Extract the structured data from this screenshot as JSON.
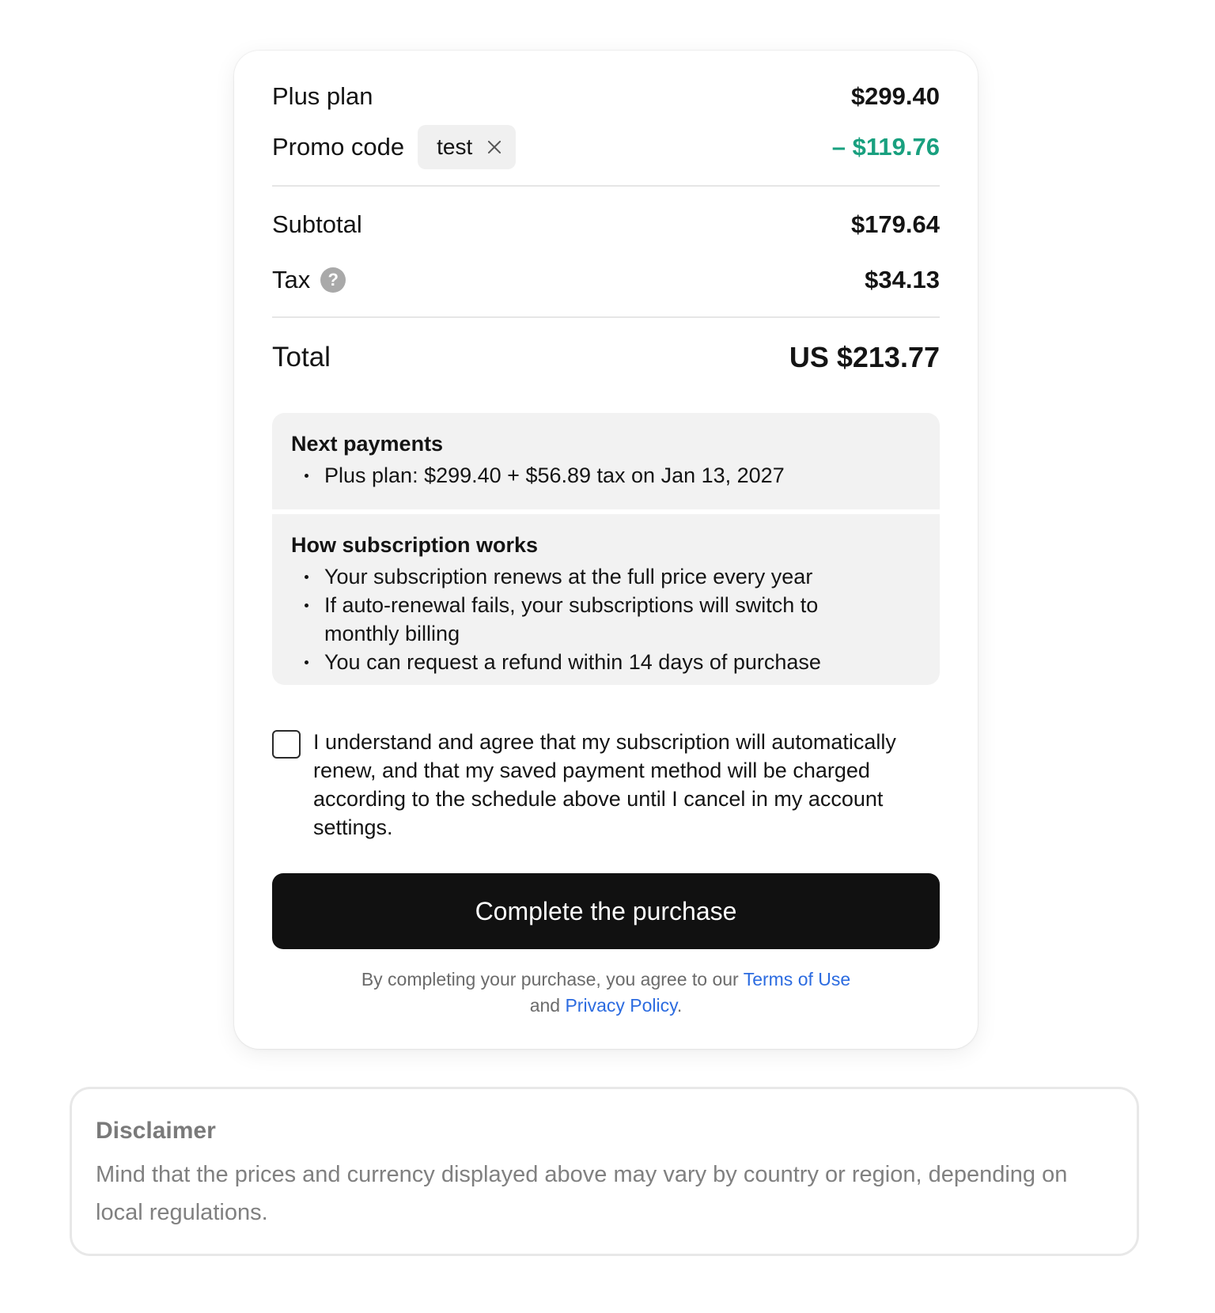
{
  "summary": {
    "plan_label": "Plus plan",
    "plan_price": "$299.40",
    "promo_label": "Promo code",
    "promo_code": "test",
    "promo_discount": "– $119.76",
    "subtotal_label": "Subtotal",
    "subtotal_value": "$179.64",
    "tax_label": "Tax",
    "tax_help_icon": "?",
    "tax_value": "$34.13",
    "total_label": "Total",
    "total_value": "US $213.77"
  },
  "next_payments": {
    "title": "Next payments",
    "items": [
      "Plus plan: $299.40 + $56.89 tax on Jan 13, 2027"
    ]
  },
  "how_it_works": {
    "title": "How subscription works",
    "items": [
      "Your subscription renews at the full price every year",
      "If auto-renewal fails, your subscriptions will switch to monthly billing",
      "You can request a refund within 14 days of purchase"
    ]
  },
  "agreement": {
    "checked": false,
    "text": "I understand and agree that my subscription will automatically renew, and that my saved payment method will be charged according to the schedule above until I cancel in my account settings."
  },
  "cta": {
    "label": "Complete the purchase"
  },
  "legal": {
    "prefix": "By completing your purchase, you agree to our ",
    "terms_link": "Terms of Use",
    "middle": " and ",
    "privacy_link": "Privacy Policy",
    "suffix": "."
  },
  "disclaimer": {
    "title": "Disclaimer",
    "text": "Mind that the prices and currency displayed above may vary by country or region, depending on local regulations."
  },
  "colors": {
    "discount": "#19a07f",
    "link": "#2b6be0",
    "cta_background": "#111111"
  }
}
